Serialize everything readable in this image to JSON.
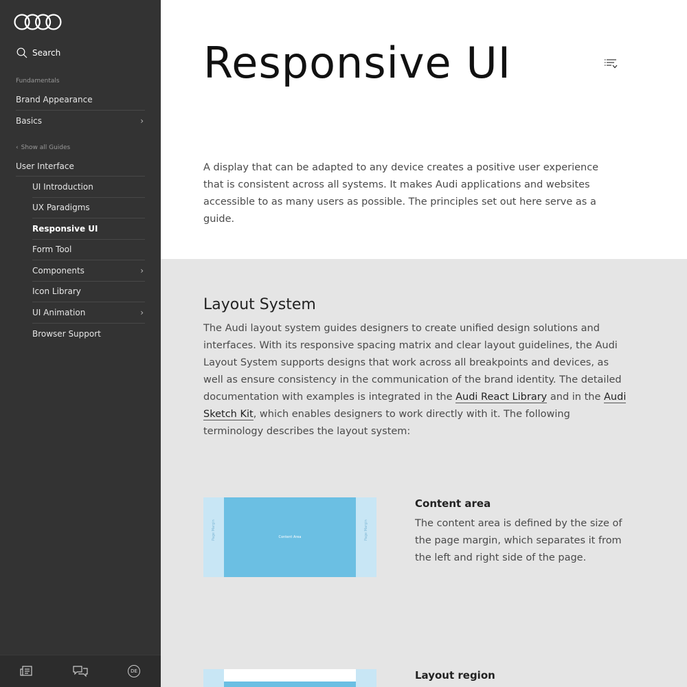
{
  "sidebar": {
    "search_label": "Search",
    "section_fundamentals": "Fundamentals",
    "fundamentals_items": [
      {
        "label": "Brand Appearance"
      },
      {
        "label": "Basics",
        "chevron": "›"
      }
    ],
    "back_label": "Show all Guides",
    "back_icon": "‹",
    "current_guide": "User Interface",
    "sub_items": [
      {
        "label": "UI Introduction"
      },
      {
        "label": "UX Paradigms"
      },
      {
        "label": "Responsive UI",
        "active": true
      },
      {
        "label": "Form Tool"
      },
      {
        "label": "Components",
        "chevron": "›"
      },
      {
        "label": "Icon Library"
      },
      {
        "label": "UI Animation",
        "chevron": "›"
      },
      {
        "label": "Browser Support"
      }
    ],
    "footer": {
      "language": "DE",
      "icons": [
        "news-icon",
        "feedback-icon",
        "language-icon"
      ]
    }
  },
  "page": {
    "title": "Responsive UI",
    "intro": "A display that can be adapted to any device creates a positive user experience that is consistent across all systems. It makes Audi applications and websites accessible to as many users as possible. The principles set out here serve as a guide."
  },
  "layout_section": {
    "title": "Layout System",
    "text_before": "The Audi layout system guides designers to create unified design solutions and interfaces. With its responsive spacing matrix and clear layout guidelines, the Audi Layout System supports designs that work across all breakpoints and devices, as well as ensure consistency in the communication of the brand identity. The detailed documentation with examples is integrated in the ",
    "link1": "Audi React Library",
    "text_middle": " and in the ",
    "link2": "Audi Sketch Kit",
    "text_after": ", which enables designers to work directly with it. The following terminology describes the layout system:"
  },
  "content_area": {
    "title": "Content area",
    "text": "The content area is defined by the size of the page margin, which separates it from the left and right side of the page.",
    "diagram_center_label": "Content Area",
    "diagram_margin_label": "Page Margin"
  },
  "layout_region": {
    "title": "Layout region"
  },
  "colors": {
    "sidebar_bg": "#333333",
    "section_bg": "#e5e5e5",
    "diagram_blue": "#6bbfe3",
    "diagram_light_blue": "#c8e6f5"
  }
}
